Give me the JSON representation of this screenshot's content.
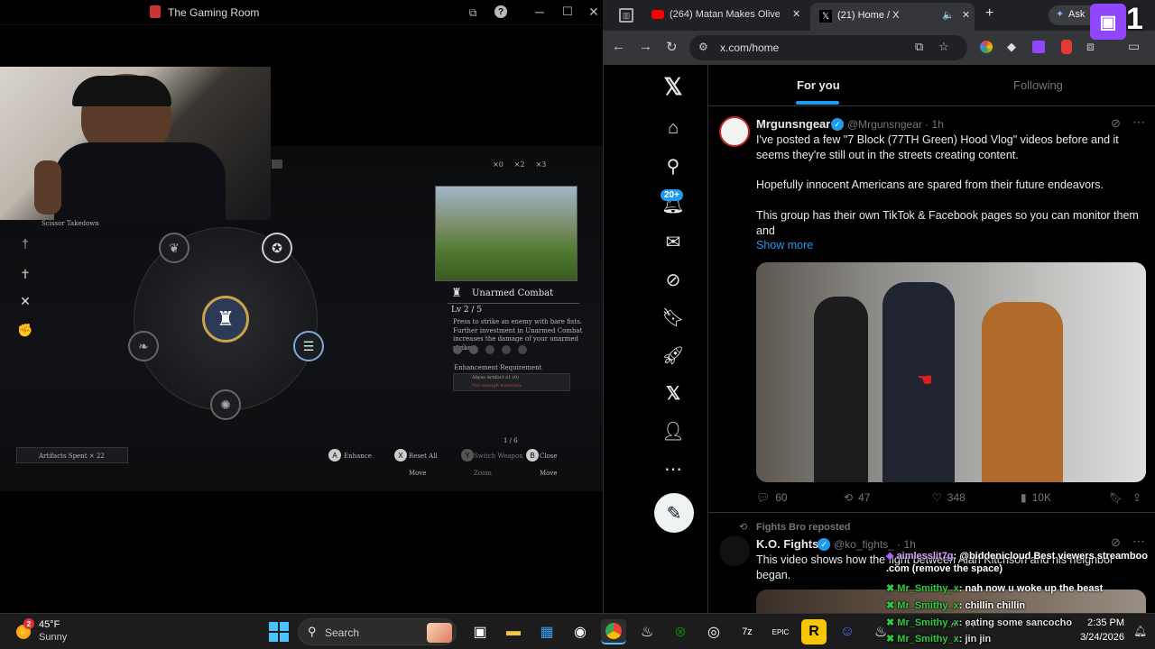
{
  "obs": {
    "title": "The Gaming Room"
  },
  "game": {
    "skill_name": "Unarmed Combat",
    "level": "Lv 2 / 5",
    "description": "Press to strike an enemy with bare fists. Further investment in Unarmed Combat increases the damage of your unarmed strikes.",
    "enhancement_label": "Enhancement Requirement",
    "req_text": "Abyss Artifact x1 (0)",
    "req_status": "Not enough materials",
    "page": "1 / 6",
    "artifacts_spent": "Artifacts Spent × 22",
    "counters": [
      "×0",
      "×2",
      "×3"
    ],
    "takedown": "Scissor Takedown",
    "controls": {
      "enhance": "Enhance",
      "reset": "Reset All",
      "switch": "Switch Weapon",
      "close": "Close",
      "move1": "Move",
      "zoom": "Zoom",
      "move2": "Move"
    }
  },
  "browser": {
    "tabs": [
      {
        "label": "(264) Matan Makes Oliver Tr"
      },
      {
        "label": "(21) Home / X"
      }
    ],
    "ask": "Ask",
    "url": "x.com/home"
  },
  "x": {
    "tabs": {
      "for_you": "For you",
      "following": "Following"
    },
    "badge": "20+",
    "tweet1": {
      "name": "Mrgunsngear",
      "handle": "@Mrgunsngear · 1h",
      "p1": "I've posted a few \"7 Block (77TH Green) Hood Vlog\" videos before and it seems they're still out in the streets creating content.",
      "p2": "Hopefully innocent Americans are spared from their future endeavors.",
      "p3": "This group has their own TikTok & Facebook pages so you can monitor them and",
      "show_more": "Show more",
      "replies": "60",
      "reposts": "47",
      "likes": "348",
      "views": "10K"
    },
    "tweet2": {
      "repost_by": "Fights Bro reposted",
      "name": "K.O. Fights",
      "handle": "@ko_fights_ · 1h",
      "text": "This video shows how the fight between Alan Kitchson and his neighbor began."
    }
  },
  "chat": [
    {
      "user": "aimlesslit7g",
      "msg": ": @biddenicloud Best viewers streamboo .com (remove the space)"
    },
    {
      "user": "Mr_Smithy_x",
      "msg": ": nah now u woke up the beast"
    },
    {
      "user": "Mr_Smithy_x",
      "msg": ": chillin chillin"
    },
    {
      "user": "Mr_Smithy_x",
      "msg": ": eating some sancocho"
    },
    {
      "user": "Mr_Smithy_x",
      "msg": ": jin jin"
    }
  ],
  "taskbar": {
    "weather_badge": "2",
    "temp": "45°F",
    "condition": "Sunny",
    "search": "Search",
    "time": "2:35 PM",
    "date": "3/24/2026"
  },
  "colors": {
    "x_blue": "#1d9bf0",
    "twitch": "#9146ff",
    "chat_green": "#2ecc40"
  }
}
